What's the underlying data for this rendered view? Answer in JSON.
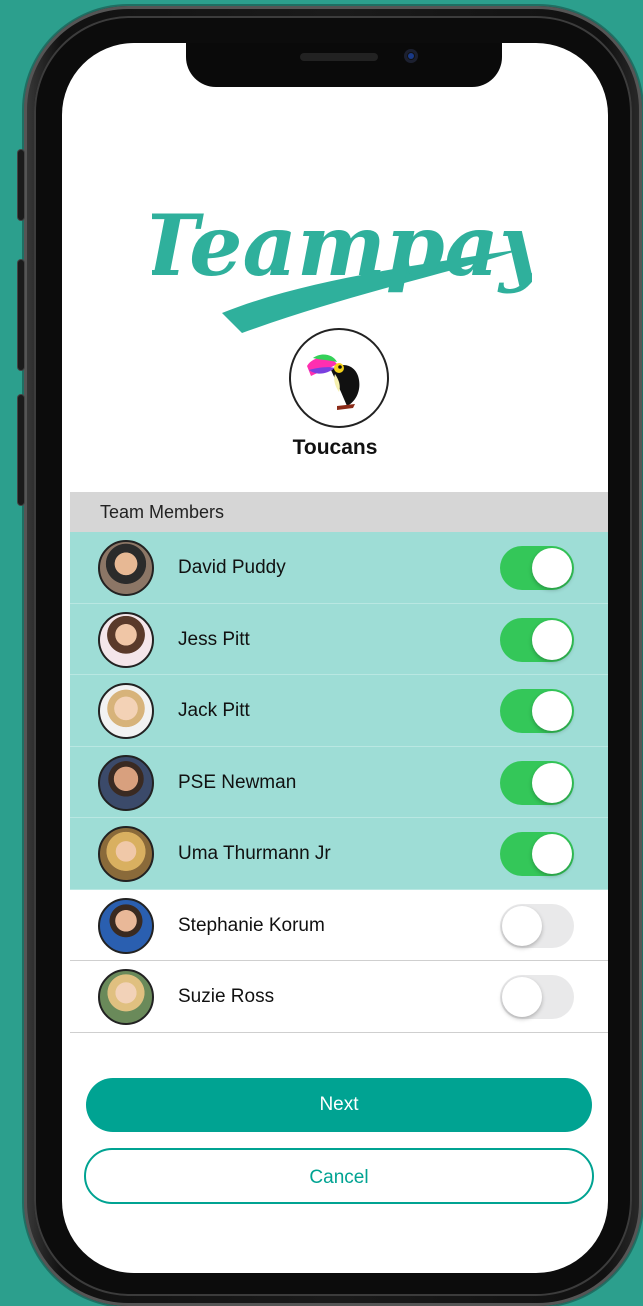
{
  "app": {
    "logo_text": "Teampay",
    "brand_color": "#2fb09c",
    "accent_color": "#00a392"
  },
  "team": {
    "name": "Toucans",
    "avatar_icon": "toucan-icon"
  },
  "members_section": {
    "header": "Team Members",
    "members": [
      {
        "name": "David Puddy",
        "enabled": true
      },
      {
        "name": "Jess Pitt",
        "enabled": true
      },
      {
        "name": "Jack Pitt",
        "enabled": true
      },
      {
        "name": "PSE Newman",
        "enabled": true
      },
      {
        "name": "Uma Thurmann Jr",
        "enabled": true
      },
      {
        "name": "Stephanie Korum",
        "enabled": false
      },
      {
        "name": "Suzie Ross",
        "enabled": false
      }
    ],
    "selected_row_color": "#9eddd6",
    "toggle_on_color": "#34c759",
    "toggle_off_color": "#e9e9ea"
  },
  "actions": {
    "next_label": "Next",
    "cancel_label": "Cancel"
  }
}
